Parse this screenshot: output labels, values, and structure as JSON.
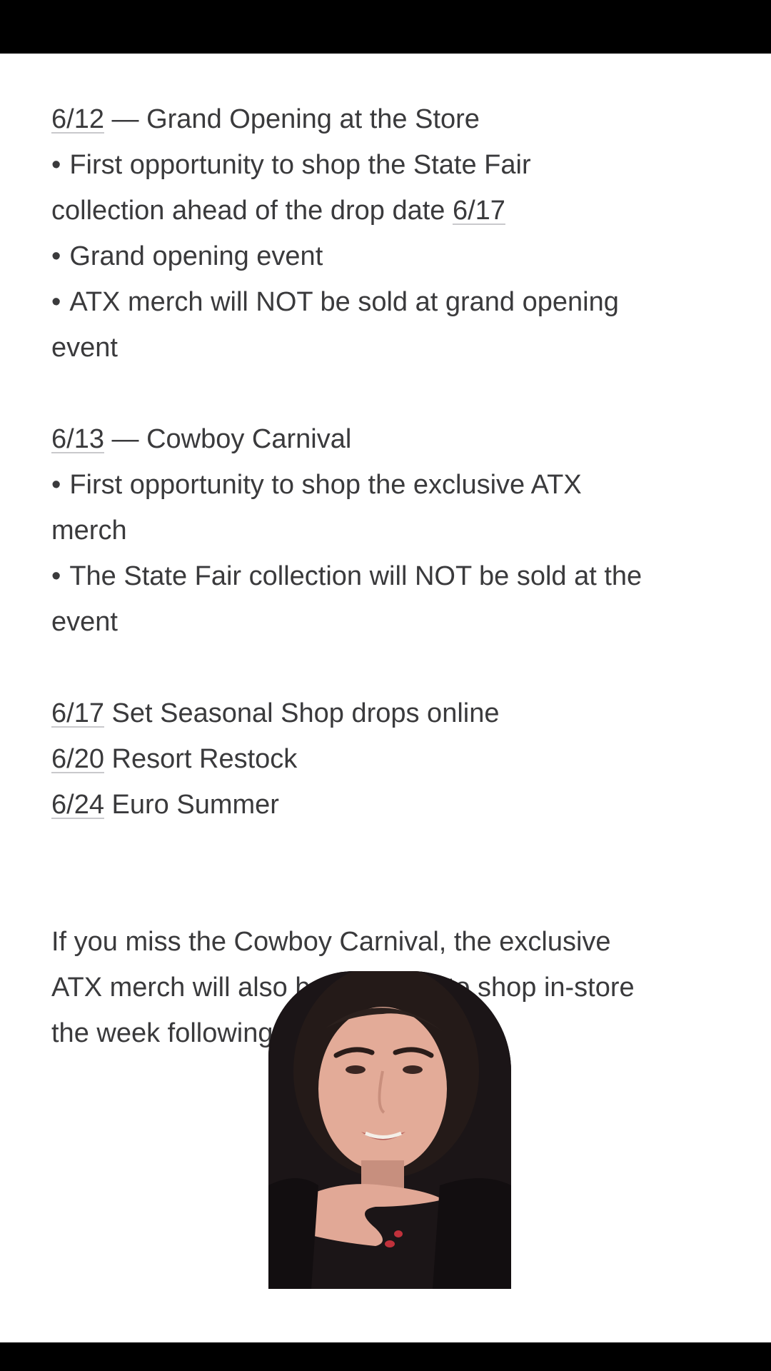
{
  "events": [
    {
      "date": "6/12",
      "title": " — Grand Opening at the Store",
      "bullets": [
        {
          "text": "First opportunity to shop the State Fair",
          "cont": "collection ahead of the drop date ",
          "cont_date": "6/17"
        },
        {
          "text": "Grand opening event"
        },
        {
          "text": "ATX merch will NOT be sold at grand opening",
          "cont": "event"
        }
      ]
    },
    {
      "date": "6/13",
      "title": " — Cowboy Carnival",
      "bullets": [
        {
          "text": "First opportunity to shop the exclusive ATX",
          "cont": "merch"
        },
        {
          "text": "The State Fair collection will NOT be sold at the",
          "cont": "event"
        }
      ]
    }
  ],
  "drops": [
    {
      "date": "6/17",
      "label": " Set Seasonal Shop drops online"
    },
    {
      "date": "6/20",
      "label": " Resort Restock"
    },
    {
      "date": "6/24",
      "label": " Euro Summer"
    }
  ],
  "closing": [
    "If you miss the Cowboy Carnival, the exclusive",
    "ATX merch will also be available to shop in-store",
    "the week following the event."
  ],
  "bullet_char": "•",
  "overlay": {
    "icon": "presenter-video-overlay"
  }
}
